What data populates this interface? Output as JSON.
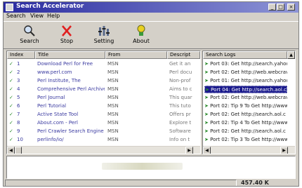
{
  "window": {
    "title": "Search Accelerator",
    "min": "_",
    "max": "□",
    "close": "×"
  },
  "menu": [
    "Search",
    "View",
    "Help"
  ],
  "toolbar": [
    {
      "label": "Search",
      "icon": "search-icon"
    },
    {
      "label": "Stop",
      "icon": "stop-icon"
    },
    {
      "label": "Setting",
      "icon": "setting-icon"
    },
    {
      "label": "About",
      "icon": "about-icon"
    }
  ],
  "results": {
    "columns": [
      "Index",
      "Title",
      "From",
      "Descript"
    ],
    "rows": [
      {
        "index": "1",
        "title": "Download Perl for Free",
        "from": "MSN",
        "desc": "Get it an"
      },
      {
        "index": "2",
        "title": "www.perl.com",
        "from": "MSN",
        "desc": "Perl docu"
      },
      {
        "index": "3",
        "title": "Perl Institute, The",
        "from": "MSN",
        "desc": "Non-prof"
      },
      {
        "index": "4",
        "title": "Comprehensive Perl Archive ...",
        "from": "MSN",
        "desc": "Aims to c"
      },
      {
        "index": "5",
        "title": "Perl Journal",
        "from": "MSN",
        "desc": "This quar"
      },
      {
        "index": "6",
        "title": "Perl Tutorial",
        "from": "MSN",
        "desc": "This tuto"
      },
      {
        "index": "7",
        "title": "Active State Tool",
        "from": "MSN",
        "desc": "Offers pr"
      },
      {
        "index": "8",
        "title": "About.com - Perl",
        "from": "MSN",
        "desc": "Explore t"
      },
      {
        "index": "9",
        "title": "Perl Crawler Search Engine",
        "from": "MSN",
        "desc": "Software"
      },
      {
        "index": "10",
        "title": "perlinfo/io/",
        "from": "MSN",
        "desc": "Info on t"
      }
    ]
  },
  "log": {
    "header": "Search Logs",
    "selected_index": 3,
    "rows": [
      "Port 03: Get http://search.yahoo",
      "Port 02: Get http://web.webcrav",
      "Port 01: Get http://search.yahoo",
      "Port 04: Get http://search.aol.c",
      "Port 02: Get http://web.webcrav",
      "Port 02: Tip 9 To Get http://www",
      "Port 02: Get http://search.aol.c",
      "Port 02: Tip 4 To Get http://www",
      "Port 02: Get http://search.aol.c",
      "Port 02: Tip 3 To Get http://www"
    ]
  },
  "status": {
    "size": "457.40 K"
  }
}
